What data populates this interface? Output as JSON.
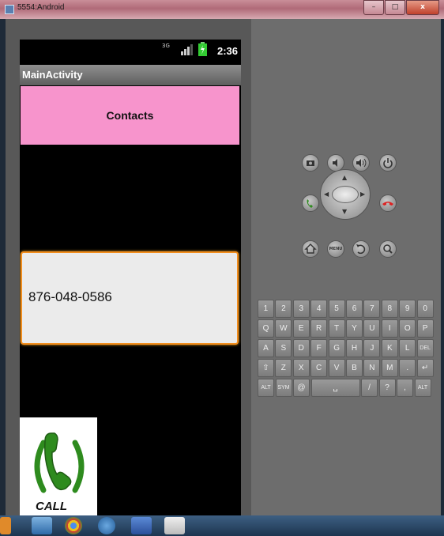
{
  "window": {
    "title": "5554:Android",
    "minimize": "–",
    "maximize": "□",
    "close": "x"
  },
  "status_bar": {
    "network": "3G",
    "time": "2:36"
  },
  "action_bar": {
    "title": "MainActivity"
  },
  "contacts_button": {
    "label": "Contacts"
  },
  "phone_field": {
    "value": "876-048-0586"
  },
  "call_button": {
    "label": "CALL"
  },
  "hardware_buttons": {
    "menu": "MENU"
  },
  "keyboard": {
    "row1": [
      "1",
      "2",
      "3",
      "4",
      "5",
      "6",
      "7",
      "8",
      "9",
      "0"
    ],
    "row2": [
      "Q",
      "W",
      "E",
      "R",
      "T",
      "Y",
      "U",
      "I",
      "O",
      "P"
    ],
    "row3": [
      "A",
      "S",
      "D",
      "F",
      "G",
      "H",
      "J",
      "K",
      "L",
      "DEL"
    ],
    "row4": [
      "⇧",
      "Z",
      "X",
      "C",
      "V",
      "B",
      "N",
      "M",
      ".",
      "↵"
    ],
    "row5": [
      "ALT",
      "SYM",
      "@",
      "␣",
      "/",
      "?",
      ",",
      "ALT"
    ]
  },
  "colors": {
    "contacts_bg": "#f794cc",
    "focus_border": "#f28e1e",
    "call_green": "#2e8b1e",
    "end_red": "#d22"
  }
}
